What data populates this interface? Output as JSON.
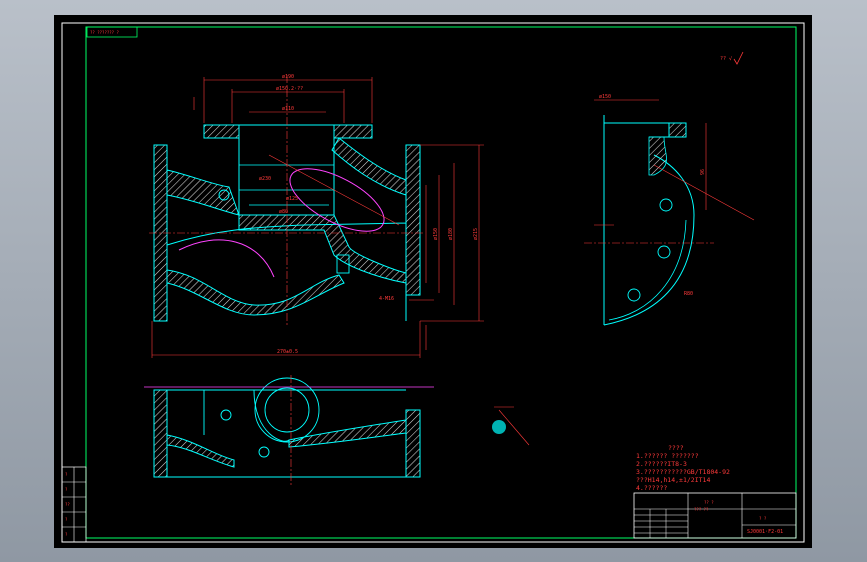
{
  "notes": {
    "heading": "????",
    "lines": [
      "1.?????? ???????",
      "2.??????IT8-3",
      "3.???????????GB/T1804-92",
      "  ???H14,h14,±1/2IT14",
      "4.??????"
    ]
  },
  "title_block": {
    "center_text_1": "?? ?",
    "center_text_2": "??? ??",
    "drawing_code": "SJ0001·F2-01",
    "marks": "? ?"
  },
  "corner_tag": "?? ??????? ?",
  "roughness_note": "?? √",
  "left_strip": [
    "?",
    "?",
    "??",
    "?",
    "?"
  ],
  "dimensions": {
    "top_width": "ø190",
    "bolt_circle": "ø150.2·??",
    "inner_dia": "ø110",
    "flange_dia": "ø230",
    "seat": "ø125",
    "bore": "ø80",
    "overall_length": "270±0.5",
    "height": "175",
    "right_h1": "ø215",
    "right_h2": "ø180",
    "right_h3": "ø150",
    "thread": "4-M16",
    "side_top": "ø150",
    "side_height": "96",
    "side_r": "R80"
  }
}
